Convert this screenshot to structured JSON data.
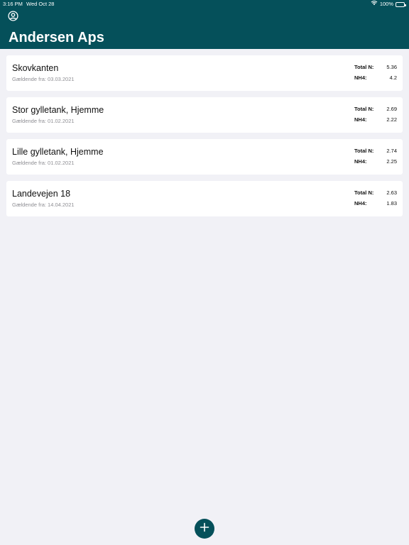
{
  "status_bar": {
    "time": "3:16 PM",
    "date": "Wed Oct 28",
    "battery_text": "100%",
    "wifi_icon": "wifi-icon",
    "battery_icon": "battery-icon",
    "battery_level": 1.0
  },
  "header": {
    "title": "Andersen Aps",
    "profile_icon": "person-circle-icon",
    "background_color": "#05505a"
  },
  "storages": [
    {
      "name": "Skovkanten",
      "valid_from": "Gældende fra: 03.03.2021",
      "total_n_label": "Total N:",
      "total_n": "5.36",
      "nh4_label": "NH4:",
      "nh4": "4.2"
    },
    {
      "name": "Stor gylletank, Hjemme",
      "valid_from": "Gældende fra: 01.02.2021",
      "total_n_label": "Total N:",
      "total_n": "2.69",
      "nh4_label": "NH4:",
      "nh4": "2.22"
    },
    {
      "name": "Lille gylletank, Hjemme",
      "valid_from": "Gældende fra: 01.02.2021",
      "total_n_label": "Total N:",
      "total_n": "2.74",
      "nh4_label": "NH4:",
      "nh4": "2.25"
    },
    {
      "name": "Landevejen 18",
      "valid_from": "Gældende fra: 14.04.2021",
      "total_n_label": "Total N:",
      "total_n": "2.63",
      "nh4_label": "NH4:",
      "nh4": "1.83"
    }
  ],
  "fab": {
    "icon": "plus-icon",
    "color": "#05505a"
  }
}
